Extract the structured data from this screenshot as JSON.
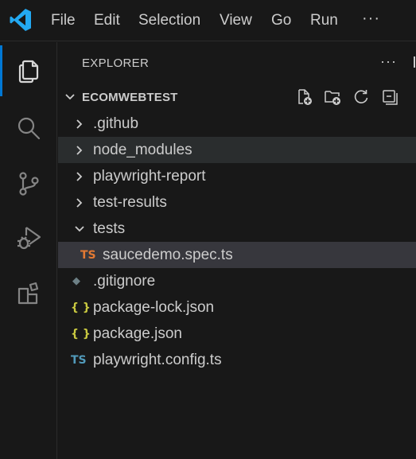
{
  "menu": {
    "file": "File",
    "edit": "Edit",
    "selection": "Selection",
    "view": "View",
    "go": "Go",
    "run": "Run",
    "more": "···"
  },
  "activity_bar": {
    "items": [
      "explorer",
      "search",
      "source-control",
      "run-and-debug",
      "extensions"
    ],
    "active": "explorer"
  },
  "explorer": {
    "title": "EXPLORER",
    "more": "···",
    "workspace": "ECOMWEBTEST",
    "actions": [
      "new-file",
      "new-folder",
      "refresh",
      "collapse-all"
    ]
  },
  "tree": [
    {
      "name": ".github",
      "type": "folder",
      "expanded": false
    },
    {
      "name": "node_modules",
      "type": "folder",
      "expanded": false
    },
    {
      "name": "playwright-report",
      "type": "folder",
      "expanded": false
    },
    {
      "name": "test-results",
      "type": "folder",
      "expanded": false
    },
    {
      "name": "tests",
      "type": "folder",
      "expanded": true
    },
    {
      "name": "saucedemo.spec.ts",
      "type": "file",
      "icon_text": "TS",
      "icon_color": "#e37933"
    },
    {
      "name": ".gitignore",
      "type": "file",
      "icon_text": "◆",
      "icon_color": "#6d8086"
    },
    {
      "name": "package-lock.json",
      "type": "file",
      "icon_text": "{ }",
      "icon_color": "#cbcb41"
    },
    {
      "name": "package.json",
      "type": "file",
      "icon_text": "{ }",
      "icon_color": "#cbcb41"
    },
    {
      "name": "playwright.config.ts",
      "type": "file",
      "icon_text": "TS",
      "icon_color": "#519aba"
    }
  ],
  "colors": {
    "background": "#181818",
    "accent": "#0078d4",
    "selected_row": "#37373d",
    "hover_row": "#2a2d2e",
    "text": "#cccccc"
  }
}
